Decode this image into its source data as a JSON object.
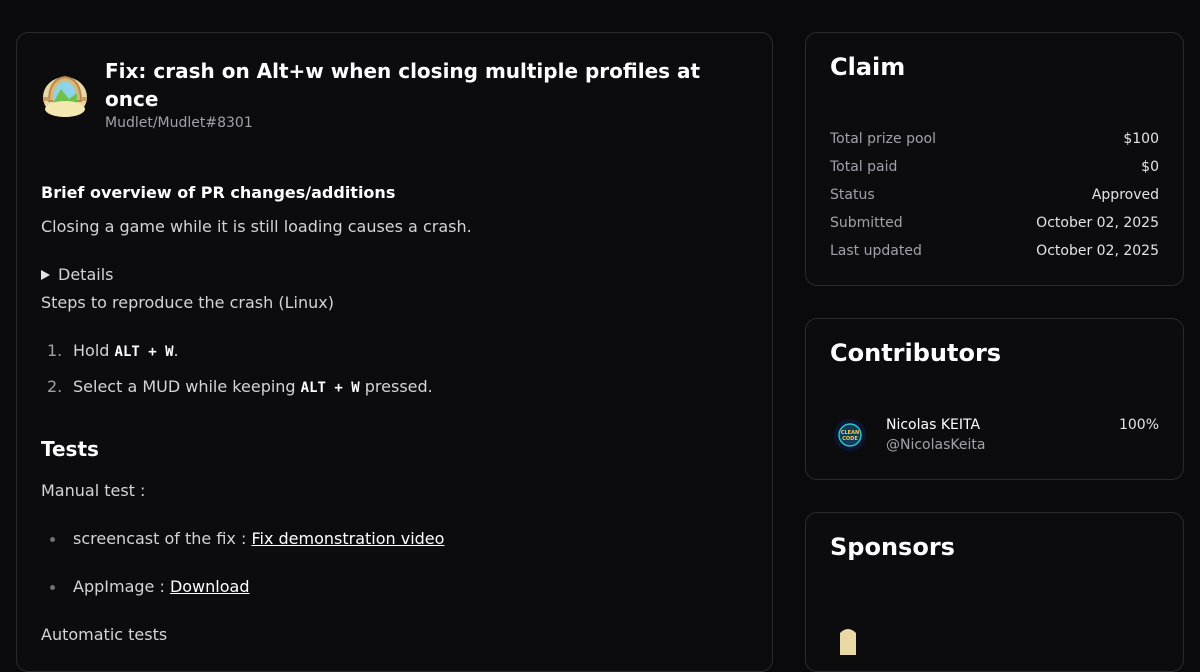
{
  "pr": {
    "title": "Fix: crash on Alt+w when closing multiple profiles at once",
    "repo": "Mudlet/Mudlet#8301",
    "overview_heading": "Brief overview of PR changes/additions",
    "overview_text": "Closing a game while it is still loading causes a crash.",
    "details_label": "Details",
    "steps_intro": "Steps to reproduce the crash (Linux)",
    "steps": [
      {
        "num": "1.",
        "before": "Hold ",
        "key": "ALT + W",
        "after": "."
      },
      {
        "num": "2.",
        "before": "Select a MUD while keeping ",
        "key": "ALT + W",
        "after": " pressed."
      }
    ],
    "tests_heading": "Tests",
    "manual_test": "Manual test :",
    "bullets": [
      {
        "prefix": "screencast of the fix : ",
        "link": "Fix demonstration video"
      },
      {
        "prefix": "AppImage : ",
        "link": "Download"
      }
    ],
    "automatic_tests": "Automatic tests"
  },
  "claim": {
    "title": "Claim",
    "rows": [
      {
        "label": "Total prize pool",
        "value": "$100"
      },
      {
        "label": "Total paid",
        "value": "$0"
      },
      {
        "label": "Status",
        "value": "Approved"
      },
      {
        "label": "Submitted",
        "value": "October 02, 2025"
      },
      {
        "label": "Last updated",
        "value": "October 02, 2025"
      }
    ]
  },
  "contributors": {
    "title": "Contributors",
    "items": [
      {
        "name": "Nicolas KEITA",
        "handle": "@NicolasKeita",
        "share": "100%",
        "avatar_text": "CLEAN CODE"
      }
    ]
  },
  "sponsors": {
    "title": "Sponsors"
  },
  "colors": {
    "background": "#0a0a0c",
    "card_border": "#2a2a30",
    "text_primary": "#ffffff",
    "text_muted": "#a1a1aa"
  }
}
